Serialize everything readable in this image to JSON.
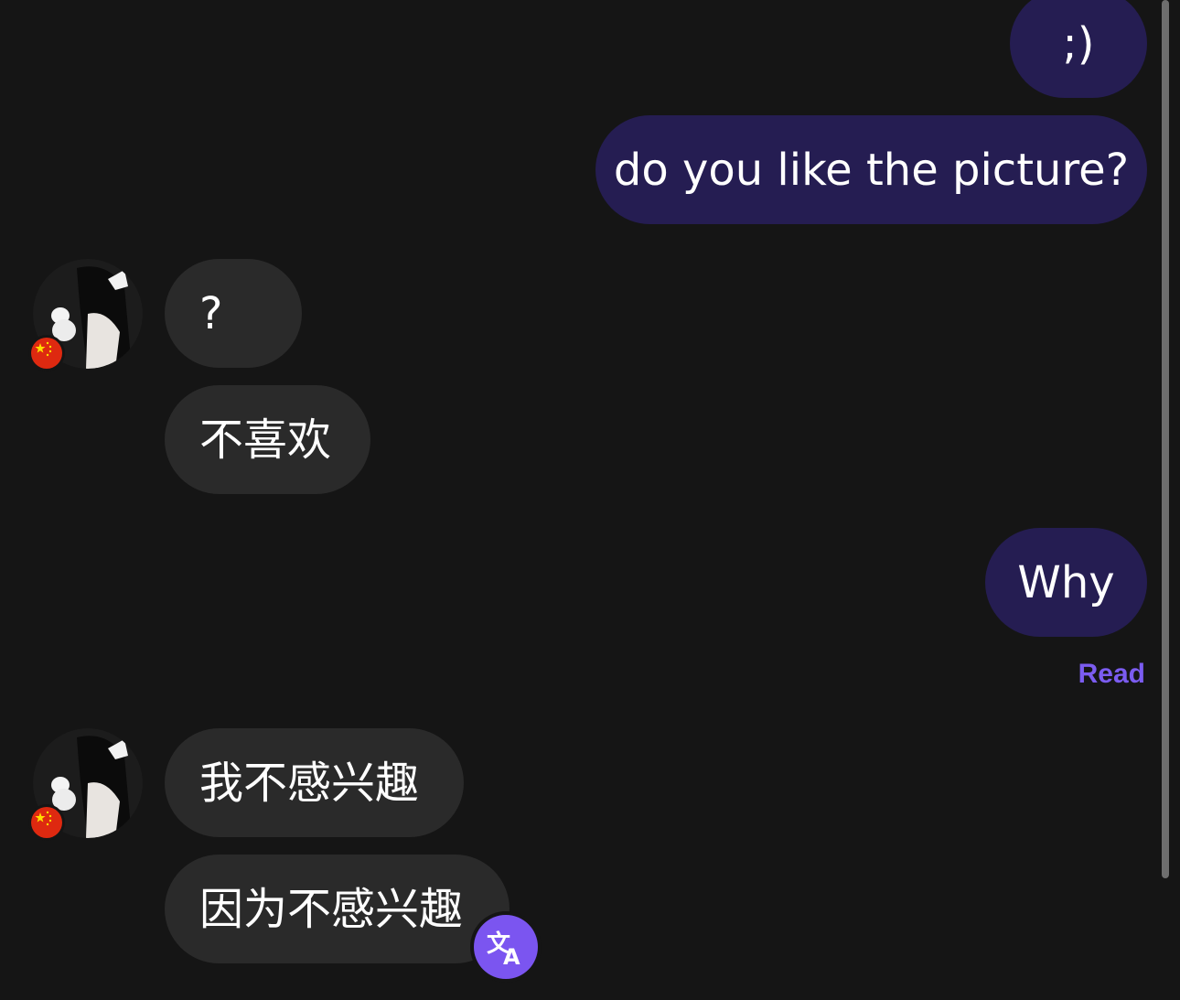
{
  "messages": {
    "out_1": ";)",
    "out_2": "do you like the picture?",
    "in_1": "?",
    "in_2": "不喜欢",
    "out_3": "Why",
    "in_3": "我不感兴趣",
    "in_4": "因为不感兴趣"
  },
  "read_status": "Read",
  "avatar": {
    "flag": "china-flag-icon"
  },
  "colors": {
    "background": "#151515",
    "outgoing_bubble": "#251d52",
    "incoming_bubble": "#2a2a2a",
    "accent": "#7b55f0"
  }
}
